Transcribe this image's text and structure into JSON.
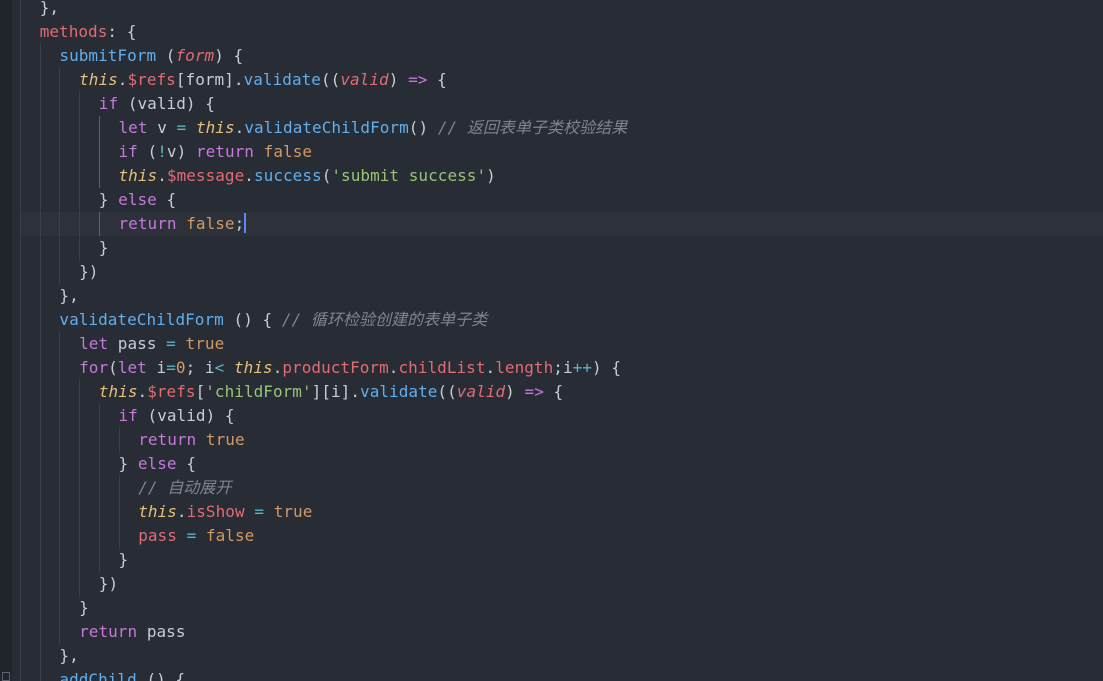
{
  "editor": {
    "colors": {
      "background": "#282c34",
      "current_line": "#2c313a",
      "caret": "#528bff",
      "keyword": "#c678dd",
      "function": "#61afef",
      "property": "#e06c75",
      "this": "#e5c07b",
      "string": "#98c379",
      "boolean": "#d19a66",
      "operator": "#56b6c2",
      "comment": "#7f848e"
    },
    "lines": [
      {
        "indent": 1,
        "tokens": [
          {
            "t": "},",
            "c": "pl"
          }
        ]
      },
      {
        "indent": 1,
        "tokens": [
          {
            "t": "methods",
            "c": "prop"
          },
          {
            "t": ": {",
            "c": "pl"
          }
        ]
      },
      {
        "indent": 2,
        "tokens": [
          {
            "t": "submitForm",
            "c": "fn"
          },
          {
            "t": " (",
            "c": "pl"
          },
          {
            "t": "form",
            "c": "param"
          },
          {
            "t": ") {",
            "c": "pl"
          }
        ]
      },
      {
        "indent": 3,
        "tokens": [
          {
            "t": "this",
            "c": "self"
          },
          {
            "t": ".",
            "c": "pl"
          },
          {
            "t": "$refs",
            "c": "prop"
          },
          {
            "t": "[form].",
            "c": "pl"
          },
          {
            "t": "validate",
            "c": "fn"
          },
          {
            "t": "((",
            "c": "pl"
          },
          {
            "t": "valid",
            "c": "param"
          },
          {
            "t": ") ",
            "c": "pl"
          },
          {
            "t": "=>",
            "c": "kw"
          },
          {
            "t": " {",
            "c": "pl"
          }
        ]
      },
      {
        "indent": 4,
        "tokens": [
          {
            "t": "if",
            "c": "kw"
          },
          {
            "t": " (valid) {",
            "c": "pl"
          }
        ]
      },
      {
        "indent": 5,
        "tokens": [
          {
            "t": "let",
            "c": "kw"
          },
          {
            "t": " v ",
            "c": "pl"
          },
          {
            "t": "=",
            "c": "op"
          },
          {
            "t": " ",
            "c": "pl"
          },
          {
            "t": "this",
            "c": "self"
          },
          {
            "t": ".",
            "c": "pl"
          },
          {
            "t": "validateChildForm",
            "c": "fn"
          },
          {
            "t": "() ",
            "c": "pl"
          },
          {
            "t": "// 返回表单子类校验结果",
            "c": "cm"
          }
        ]
      },
      {
        "indent": 5,
        "tokens": [
          {
            "t": "if",
            "c": "kw"
          },
          {
            "t": " (",
            "c": "pl"
          },
          {
            "t": "!",
            "c": "op"
          },
          {
            "t": "v) ",
            "c": "pl"
          },
          {
            "t": "return",
            "c": "kw"
          },
          {
            "t": " ",
            "c": "pl"
          },
          {
            "t": "false",
            "c": "bool"
          }
        ]
      },
      {
        "indent": 5,
        "tokens": [
          {
            "t": "this",
            "c": "self"
          },
          {
            "t": ".",
            "c": "pl"
          },
          {
            "t": "$message",
            "c": "prop"
          },
          {
            "t": ".",
            "c": "pl"
          },
          {
            "t": "success",
            "c": "fn"
          },
          {
            "t": "(",
            "c": "pl"
          },
          {
            "t": "'submit success'",
            "c": "str"
          },
          {
            "t": ")",
            "c": "pl"
          }
        ]
      },
      {
        "indent": 4,
        "tokens": [
          {
            "t": "} ",
            "c": "pl"
          },
          {
            "t": "else",
            "c": "kw"
          },
          {
            "t": " {",
            "c": "pl"
          }
        ]
      },
      {
        "indent": 5,
        "current": true,
        "tokens": [
          {
            "t": "return",
            "c": "kw"
          },
          {
            "t": " ",
            "c": "pl"
          },
          {
            "t": "false",
            "c": "bool"
          },
          {
            "t": ";",
            "c": "pl"
          }
        ]
      },
      {
        "indent": 4,
        "tokens": [
          {
            "t": "}",
            "c": "pl"
          }
        ]
      },
      {
        "indent": 3,
        "tokens": [
          {
            "t": "})",
            "c": "pl"
          }
        ]
      },
      {
        "indent": 2,
        "tokens": [
          {
            "t": "},",
            "c": "pl"
          }
        ]
      },
      {
        "indent": 2,
        "tokens": [
          {
            "t": "validateChildForm",
            "c": "fn"
          },
          {
            "t": " () { ",
            "c": "pl"
          },
          {
            "t": "// 循环检验创建的表单子类",
            "c": "cm"
          }
        ]
      },
      {
        "indent": 3,
        "tokens": [
          {
            "t": "let",
            "c": "kw"
          },
          {
            "t": " pass ",
            "c": "pl"
          },
          {
            "t": "=",
            "c": "op"
          },
          {
            "t": " ",
            "c": "pl"
          },
          {
            "t": "true",
            "c": "bool"
          }
        ]
      },
      {
        "indent": 3,
        "tokens": [
          {
            "t": "for",
            "c": "kw"
          },
          {
            "t": "(",
            "c": "pl"
          },
          {
            "t": "let",
            "c": "kw"
          },
          {
            "t": " i",
            "c": "pl"
          },
          {
            "t": "=",
            "c": "op"
          },
          {
            "t": "0",
            "c": "num"
          },
          {
            "t": "; i",
            "c": "pl"
          },
          {
            "t": "<",
            "c": "op"
          },
          {
            "t": " ",
            "c": "pl"
          },
          {
            "t": "this",
            "c": "self"
          },
          {
            "t": ".",
            "c": "pl"
          },
          {
            "t": "productForm",
            "c": "prop"
          },
          {
            "t": ".",
            "c": "pl"
          },
          {
            "t": "childList",
            "c": "prop"
          },
          {
            "t": ".",
            "c": "pl"
          },
          {
            "t": "length",
            "c": "prop"
          },
          {
            "t": ";i",
            "c": "pl"
          },
          {
            "t": "++",
            "c": "op"
          },
          {
            "t": ") {",
            "c": "pl"
          }
        ]
      },
      {
        "indent": 4,
        "tokens": [
          {
            "t": "this",
            "c": "self"
          },
          {
            "t": ".",
            "c": "pl"
          },
          {
            "t": "$refs",
            "c": "prop"
          },
          {
            "t": "[",
            "c": "pl"
          },
          {
            "t": "'childForm'",
            "c": "str"
          },
          {
            "t": "][i].",
            "c": "pl"
          },
          {
            "t": "validate",
            "c": "fn"
          },
          {
            "t": "((",
            "c": "pl"
          },
          {
            "t": "valid",
            "c": "param"
          },
          {
            "t": ") ",
            "c": "pl"
          },
          {
            "t": "=>",
            "c": "kw"
          },
          {
            "t": " {",
            "c": "pl"
          }
        ]
      },
      {
        "indent": 5,
        "tokens": [
          {
            "t": "if",
            "c": "kw"
          },
          {
            "t": " (valid) {",
            "c": "pl"
          }
        ]
      },
      {
        "indent": 6,
        "tokens": [
          {
            "t": "return",
            "c": "kw"
          },
          {
            "t": " ",
            "c": "pl"
          },
          {
            "t": "true",
            "c": "bool"
          }
        ]
      },
      {
        "indent": 5,
        "tokens": [
          {
            "t": "} ",
            "c": "pl"
          },
          {
            "t": "else",
            "c": "kw"
          },
          {
            "t": " {",
            "c": "pl"
          }
        ]
      },
      {
        "indent": 6,
        "tokens": [
          {
            "t": "// 自动展开",
            "c": "cm"
          }
        ]
      },
      {
        "indent": 6,
        "tokens": [
          {
            "t": "this",
            "c": "self"
          },
          {
            "t": ".",
            "c": "pl"
          },
          {
            "t": "isShow",
            "c": "prop"
          },
          {
            "t": " ",
            "c": "pl"
          },
          {
            "t": "=",
            "c": "op"
          },
          {
            "t": " ",
            "c": "pl"
          },
          {
            "t": "true",
            "c": "bool"
          }
        ]
      },
      {
        "indent": 6,
        "tokens": [
          {
            "t": "pass",
            "c": "prop"
          },
          {
            "t": " ",
            "c": "pl"
          },
          {
            "t": "=",
            "c": "op"
          },
          {
            "t": " ",
            "c": "pl"
          },
          {
            "t": "false",
            "c": "bool"
          }
        ]
      },
      {
        "indent": 5,
        "tokens": [
          {
            "t": "}",
            "c": "pl"
          }
        ]
      },
      {
        "indent": 4,
        "tokens": [
          {
            "t": "})",
            "c": "pl"
          }
        ]
      },
      {
        "indent": 3,
        "tokens": [
          {
            "t": "}",
            "c": "pl"
          }
        ]
      },
      {
        "indent": 3,
        "tokens": [
          {
            "t": "return",
            "c": "kw"
          },
          {
            "t": " pass",
            "c": "pl"
          }
        ]
      },
      {
        "indent": 2,
        "tokens": [
          {
            "t": "},",
            "c": "pl"
          }
        ]
      },
      {
        "indent": 2,
        "tokens": [
          {
            "t": "addChild",
            "c": "fn"
          },
          {
            "t": " () {",
            "c": "pl"
          }
        ]
      }
    ]
  }
}
